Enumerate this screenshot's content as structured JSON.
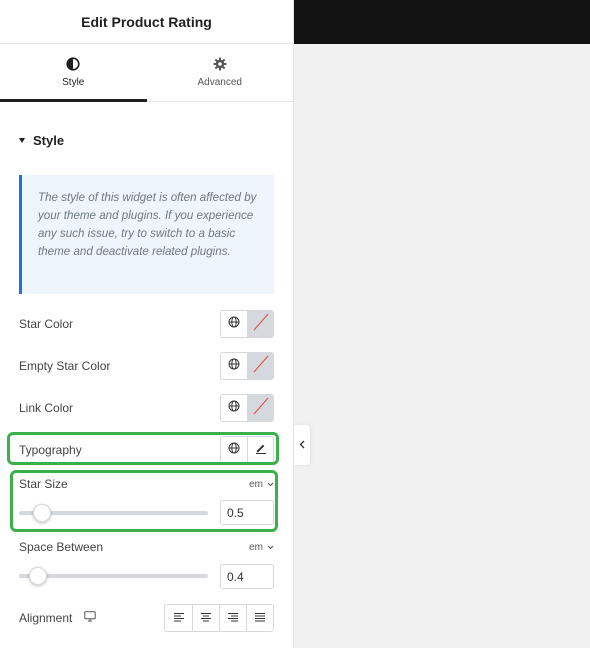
{
  "panel": {
    "title": "Edit Product Rating",
    "tabs": [
      {
        "label": "Style",
        "icon": "half-circle-icon",
        "active": true
      },
      {
        "label": "Advanced",
        "icon": "gear-icon",
        "active": false
      }
    ]
  },
  "section": {
    "label": "Style",
    "notice": "The style of this widget is often affected by your theme and plugins. If you experience any such issue, try to switch to a basic theme and deactivate related plugins."
  },
  "controls": {
    "star_color": {
      "label": "Star Color"
    },
    "empty_star_color": {
      "label": "Empty Star Color"
    },
    "link_color": {
      "label": "Link Color"
    },
    "typography": {
      "label": "Typography"
    },
    "star_size": {
      "label": "Star Size",
      "unit": "em",
      "value": "0.5",
      "slider_fraction": 0.08
    },
    "space_between": {
      "label": "Space Between",
      "unit": "em",
      "value": "0.4",
      "slider_fraction": 0.06
    },
    "alignment": {
      "label": "Alignment",
      "options": [
        "left",
        "center",
        "right",
        "justify"
      ]
    }
  },
  "colors": {
    "highlight": "#3cb04a",
    "notice_border": "#2271d6",
    "notice_bg": "#eef5fd",
    "topbar": "#121212"
  }
}
